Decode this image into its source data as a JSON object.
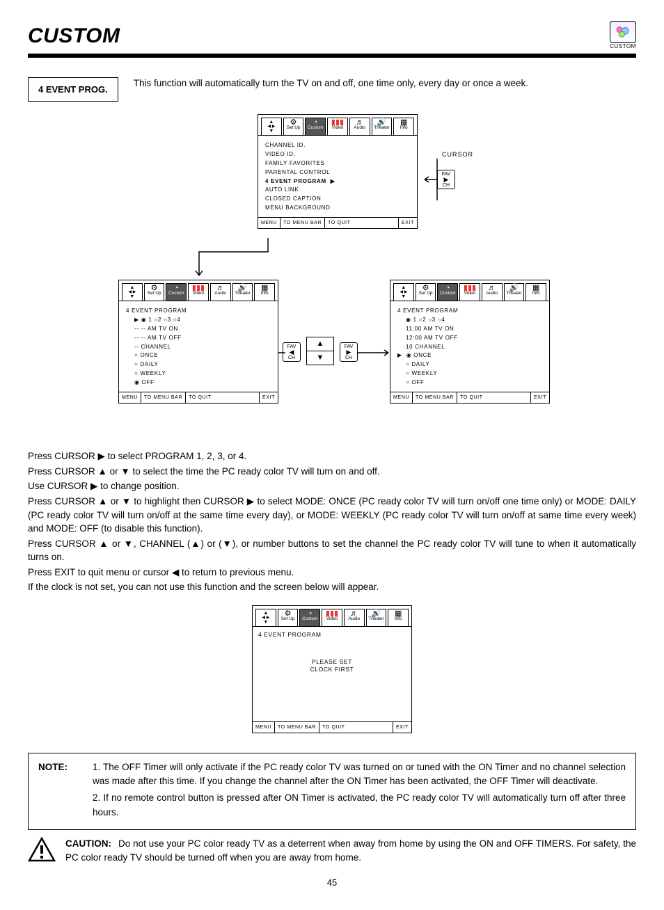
{
  "page": {
    "title": "CUSTOM",
    "header_icon_label": "CUSTOM",
    "page_number": "45"
  },
  "section": {
    "label": "4 EVENT PROG.",
    "lead": "This function will automatically turn the TV on and off, one time only, every day or once a week."
  },
  "osd": {
    "tabs": [
      "Set Up",
      "Custom",
      "Video",
      "Audio",
      "Theater",
      "Info"
    ],
    "cursor_label": "CURSOR",
    "fav_label_top": "FAV",
    "fav_label_bottom": "CH",
    "footer": {
      "menu": "MENU",
      "bar": "TO MENU BAR",
      "quit": "TO QUIT",
      "exit": "EXIT"
    },
    "top_menu": {
      "items": [
        "CHANNEL ID.",
        "VIDEO ID.",
        "FAMILY FAVORITES",
        "PARENTAL CONTROL",
        "4 EVENT PROGRAM",
        "AUTO LINK",
        "CLOSED CAPTION",
        "MENU BACKGROUND"
      ],
      "selected_index": 4
    },
    "left_menu": {
      "title": "4 EVENT PROGRAM",
      "prog_row_label": "1   ○2   ○3   ○4",
      "rows": [
        "-- -- AM TV ON",
        "-- -- AM TV OFF",
        " -- CHANNEL",
        "○  ONCE",
        "○  DAILY",
        "○  WEEKLY",
        "◉  OFF"
      ]
    },
    "right_menu": {
      "title": "4 EVENT PROGRAM",
      "prog_row_label": "◉ 1   ○2   ○3   ○4",
      "rows": [
        "11:00 AM TV ON",
        "12:00 AM TV OFF",
        "10 CHANNEL",
        "◉  ONCE",
        "○  DAILY",
        "○  WEEKLY",
        "○  OFF"
      ],
      "selected_row_index": 3
    },
    "clock_panel": {
      "title": "4 EVENT PROGRAM",
      "message_line1": "PLEASE SET",
      "message_line2": "CLOCK FIRST"
    }
  },
  "instructions": {
    "lines": [
      "Press CURSOR ▶ to select PROGRAM 1, 2, 3, or 4.",
      "Press CURSOR ▲ or ▼ to select the time the PC ready color TV will turn on and off.",
      "Use CURSOR ▶ to change position.",
      "Press CURSOR ▲ or ▼ to highlight then CURSOR ▶ to select MODE: ONCE (PC ready color TV will turn on/off one time only) or MODE: DAILY (PC ready color TV will turn on/off at the same time every day), or MODE: WEEKLY (PC ready color TV will turn on/off at same time every week) and MODE: OFF (to disable this function).",
      "Press CURSOR ▲ or ▼, CHANNEL (▲) or (▼), or number buttons to set the channel the PC ready color TV will tune to when it automatically turns on.",
      "Press EXIT to quit menu or cursor ◀ to return to previous menu.",
      "If the clock is not set, you can not use this function and the screen below will appear."
    ]
  },
  "note": {
    "label": "NOTE:",
    "item1": "1. The OFF Timer will only activate if the PC ready color TV was turned on or tuned with the ON Timer and no channel selection was made after this time.  If you change the channel after the ON Timer has been activated, the OFF Timer will deactivate.",
    "item2": "2. If no remote control button is pressed after ON Timer is activated, the PC ready color TV will automatically turn off after three hours."
  },
  "caution": {
    "label": "CAUTION:",
    "text": "Do not use your PC color ready TV as a deterrent when away from home by using the ON and OFF TIMERS.  For safety, the PC color ready TV should be turned off when you are away from home."
  }
}
